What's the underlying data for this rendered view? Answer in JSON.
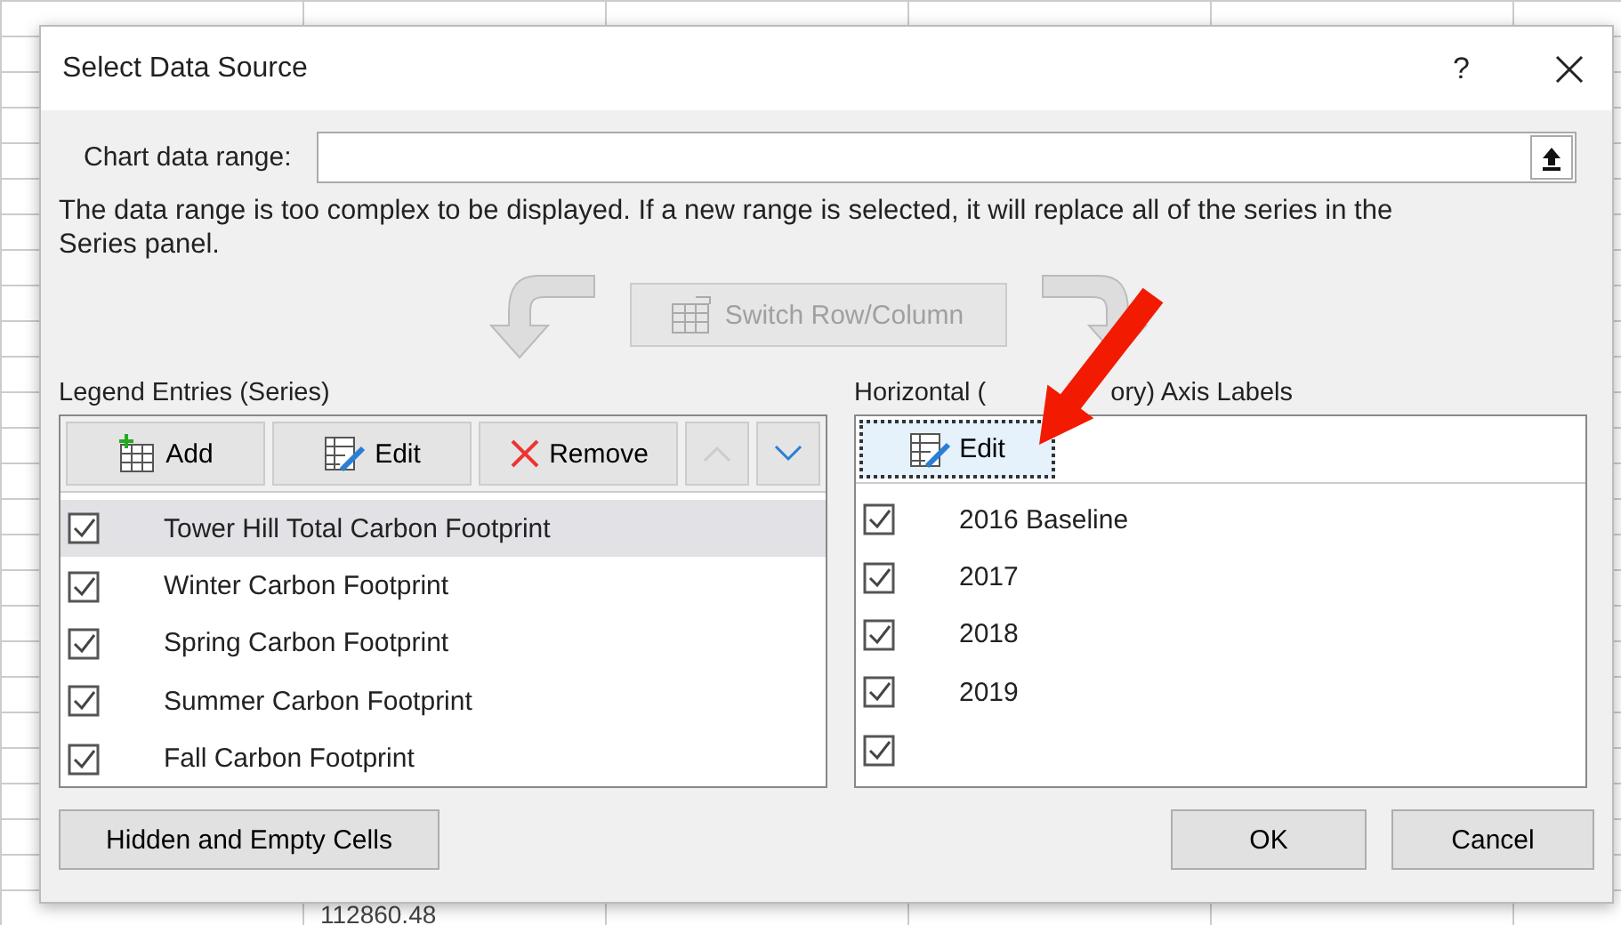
{
  "spreadsheet": {
    "cells": [
      "112860.48"
    ]
  },
  "dialog": {
    "title": "Select Data Source",
    "help": "?",
    "range": {
      "label": "Chart data range:"
    },
    "message": "The data range is too complex to be displayed. If a new range is selected, it will replace all of the series in the Series panel.",
    "switch_button": {
      "label": "Switch Row/Column",
      "disabled": true
    },
    "legend": {
      "title": "Legend Entries (Series)",
      "buttons": [
        {
          "kind": "add",
          "label": "Add",
          "disabled": false
        },
        {
          "kind": "edit",
          "label": "Edit",
          "disabled": false
        },
        {
          "kind": "remove",
          "label": "Remove",
          "disabled": false
        },
        {
          "kind": "up",
          "disabled": true
        },
        {
          "kind": "down",
          "disabled": false
        }
      ],
      "series": [
        {
          "name": "Tower Hill Total Carbon Footprint",
          "checked": true,
          "selected": true
        },
        {
          "name": "Winter Carbon Footprint",
          "checked": true,
          "selected": false
        },
        {
          "name": "Spring Carbon Footprint",
          "checked": true,
          "selected": false
        },
        {
          "name": "Summer Carbon Footprint",
          "checked": true,
          "selected": false
        },
        {
          "name": "Fall Carbon Footprint",
          "checked": true,
          "selected": false
        }
      ]
    },
    "axis": {
      "title_parts": [
        "Horizontal (",
        "ory) Axis Labels"
      ],
      "edit_button": {
        "label": "Edit",
        "focused": true
      },
      "labels": [
        {
          "text": "2016 Baseline",
          "checked": true
        },
        {
          "text": "2017",
          "checked": true
        },
        {
          "text": "2018",
          "checked": true
        },
        {
          "text": "2019",
          "checked": true
        },
        {
          "checked": true
        }
      ]
    },
    "buttons": [
      {
        "kind": "hidden",
        "label": "Hidden and Empty Cells"
      },
      {
        "kind": "ok",
        "label": "OK"
      },
      {
        "kind": "cancel",
        "label": "Cancel"
      }
    ]
  }
}
